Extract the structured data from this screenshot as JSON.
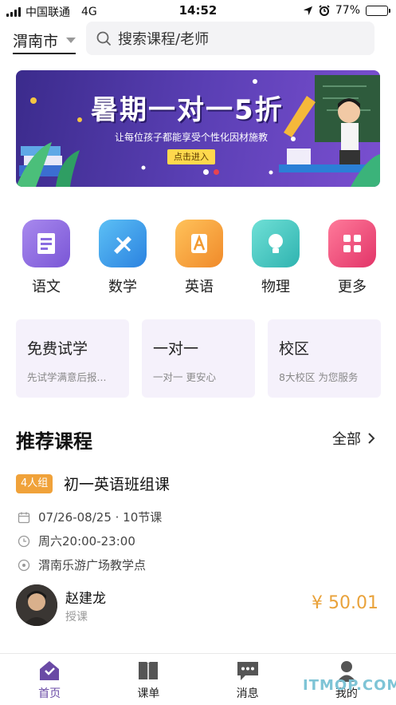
{
  "status_bar": {
    "carrier": "中国联通",
    "network": "4G",
    "time": "14:52",
    "battery": "77%",
    "battery_level": 0.77
  },
  "header": {
    "city": "渭南市",
    "search_placeholder": "搜索课程/老师"
  },
  "banner": {
    "title": "暑期一对一5折",
    "subtitle": "让每位孩子都能享受个性化因材施教",
    "button": "点击进入",
    "page_count": 2,
    "active_page": 1
  },
  "subjects": [
    {
      "label": "语文",
      "icon": "chinese-book-icon",
      "color": "#8e6ae0"
    },
    {
      "label": "数学",
      "icon": "math-ruler-icon",
      "color": "#3a9de8"
    },
    {
      "label": "英语",
      "icon": "english-letter-icon",
      "color": "#f3a53b"
    },
    {
      "label": "物理",
      "icon": "physics-bulb-icon",
      "color": "#3cc6c0"
    },
    {
      "label": "更多",
      "icon": "more-grid-icon",
      "color": "#ec4f7a"
    }
  ],
  "cards": [
    {
      "title": "免费试学",
      "subtitle": "先试学满意后报..."
    },
    {
      "title": "一对一",
      "subtitle": "一对一 更安心"
    },
    {
      "title": "校区",
      "subtitle": "8大校区 为您服务"
    }
  ],
  "section": {
    "title": "推荐课程",
    "more": "全部"
  },
  "course": {
    "tag": "4人组",
    "title": "初一英语班组课",
    "date": "07/26-08/25 · 10节课",
    "time": "周六20:00-23:00",
    "location": "渭南乐游广场教学点",
    "teacher_name": "赵建龙",
    "teacher_role": "授课",
    "price": "¥ 50.01"
  },
  "tabs": [
    {
      "label": "首页",
      "icon": "home-icon",
      "active": true
    },
    {
      "label": "课单",
      "icon": "course-list-icon",
      "active": false
    },
    {
      "label": "消息",
      "icon": "message-icon",
      "active": false
    },
    {
      "label": "我的",
      "icon": "profile-icon",
      "active": false
    }
  ],
  "watermark": "ITMOP.COM",
  "colors": {
    "accent": "#6a4aa5",
    "price": "#e9a23a",
    "tag": "#f0a23a",
    "card_bg": "#f5f1fb"
  }
}
